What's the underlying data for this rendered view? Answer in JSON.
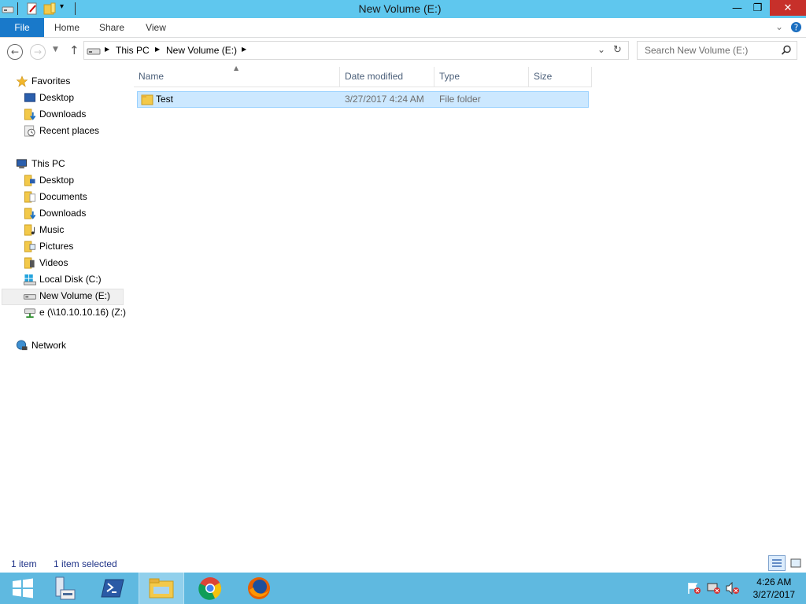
{
  "window": {
    "title": "New Volume (E:)"
  },
  "window_controls": {
    "minimize": "—",
    "restore": "❐",
    "close": "✕"
  },
  "ribbon": {
    "tabs": [
      "File",
      "Home",
      "Share",
      "View"
    ]
  },
  "address": {
    "crumbs": [
      "This PC",
      "New Volume (E:)"
    ],
    "search_placeholder": "Search New Volume (E:)"
  },
  "nav": {
    "favorites": {
      "label": "Favorites",
      "items": [
        "Desktop",
        "Downloads",
        "Recent places"
      ]
    },
    "this_pc": {
      "label": "This PC",
      "items": [
        "Desktop",
        "Documents",
        "Downloads",
        "Music",
        "Pictures",
        "Videos",
        "Local Disk (C:)",
        "New Volume (E:)",
        "e (\\\\10.10.10.16) (Z:)"
      ]
    },
    "network": {
      "label": "Network"
    },
    "selected": "New Volume (E:)"
  },
  "columns": [
    "Name",
    "Date modified",
    "Type",
    "Size"
  ],
  "files": [
    {
      "name": "Test",
      "date_modified": "3/27/2017 4:24 AM",
      "type": "File folder",
      "size": ""
    }
  ],
  "status": {
    "count": "1 item",
    "selection": "1 item selected"
  },
  "clock": {
    "time": "4:26 AM",
    "date": "3/27/2017"
  },
  "colors": {
    "titlebar": "#5fc7ee",
    "file_tab": "#1979ca",
    "selection": "#cce8ff",
    "taskbar": "#5fb9e0",
    "close_button": "#c7302a"
  }
}
